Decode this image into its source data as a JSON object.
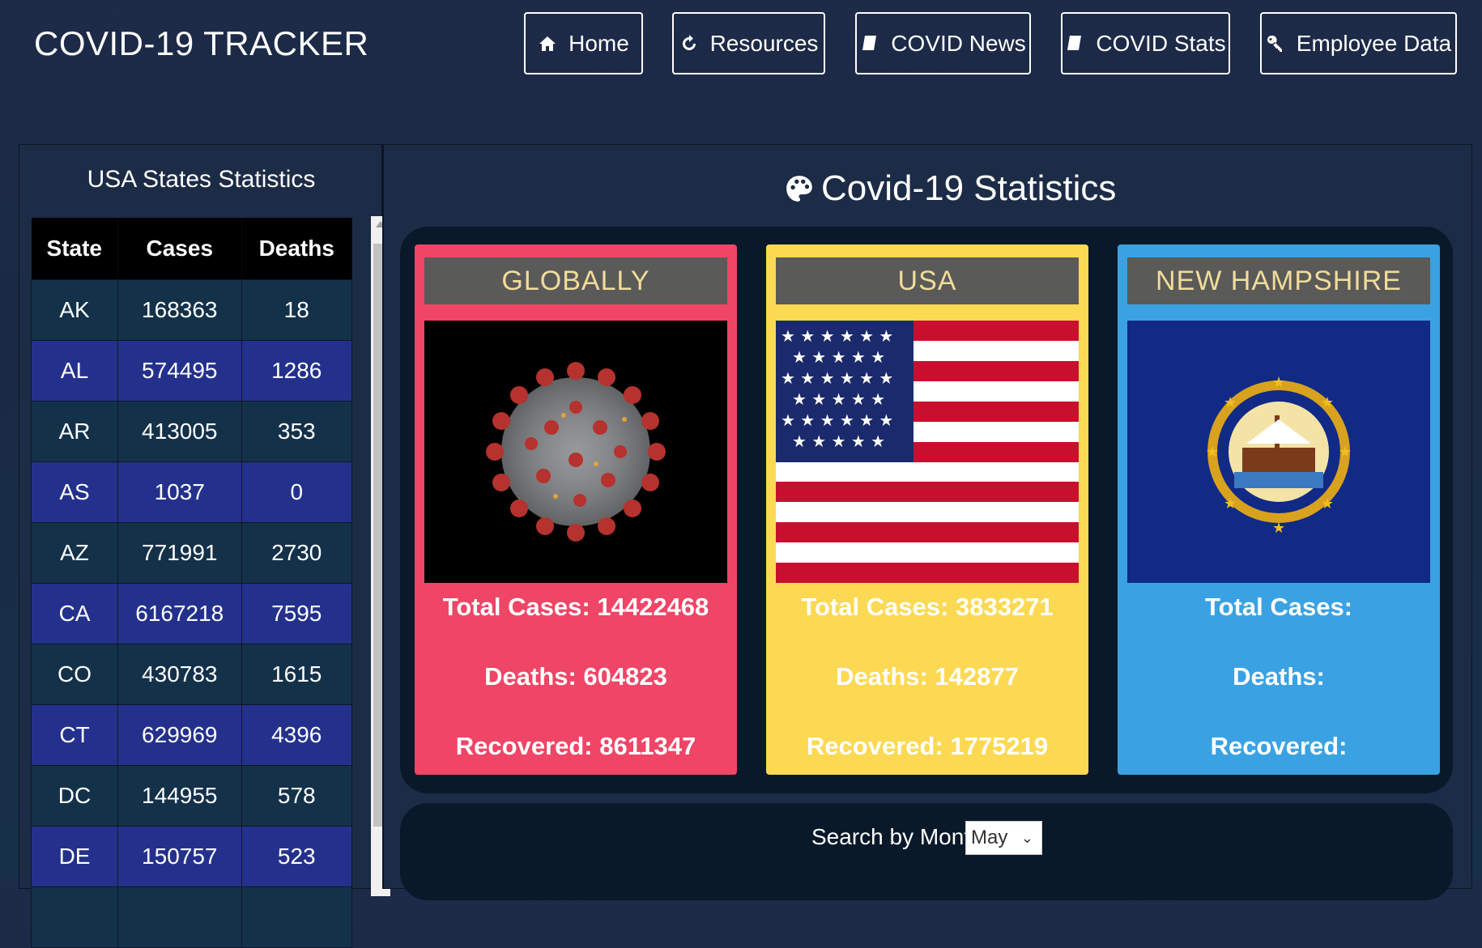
{
  "header": {
    "brand": "COVID-19 TRACKER"
  },
  "nav": [
    {
      "label": "Home",
      "icon": "home-icon"
    },
    {
      "label": "Resources",
      "icon": "refresh-icon"
    },
    {
      "label": "COVID News",
      "icon": "book-icon"
    },
    {
      "label": "COVID Stats",
      "icon": "book-icon"
    },
    {
      "label": "Employee Data",
      "icon": "key-icon"
    }
  ],
  "sidebar": {
    "title": "USA States Statistics",
    "columns": [
      "State",
      "Cases",
      "Deaths"
    ],
    "rows": [
      [
        "AK",
        "168363",
        "18"
      ],
      [
        "AL",
        "574495",
        "1286"
      ],
      [
        "AR",
        "413005",
        "353"
      ],
      [
        "AS",
        "1037",
        "0"
      ],
      [
        "AZ",
        "771991",
        "2730"
      ],
      [
        "CA",
        "6167218",
        "7595"
      ],
      [
        "CO",
        "430783",
        "1615"
      ],
      [
        "CT",
        "629969",
        "4396"
      ],
      [
        "DC",
        "144955",
        "578"
      ],
      [
        "DE",
        "150757",
        "523"
      ]
    ]
  },
  "main": {
    "title": "Covid-19 Statistics",
    "cards": [
      {
        "header": "GLOBALLY",
        "cases": "Total Cases: 14422468",
        "deaths": "Deaths: 604823",
        "recovered": "Recovered: 8611347",
        "color": "#ef4566"
      },
      {
        "header": "USA",
        "cases": "Total Cases: 3833271",
        "deaths": "Deaths: 142877",
        "recovered": "Recovered: 1775219",
        "color": "#fcd952"
      },
      {
        "header": "NEW HAMPSHIRE",
        "cases": "Total Cases:",
        "deaths": "Deaths:",
        "recovered": "Recovered:",
        "color": "#3aa2e2"
      }
    ],
    "search": {
      "label": "Search by Month",
      "selected": "May"
    }
  }
}
